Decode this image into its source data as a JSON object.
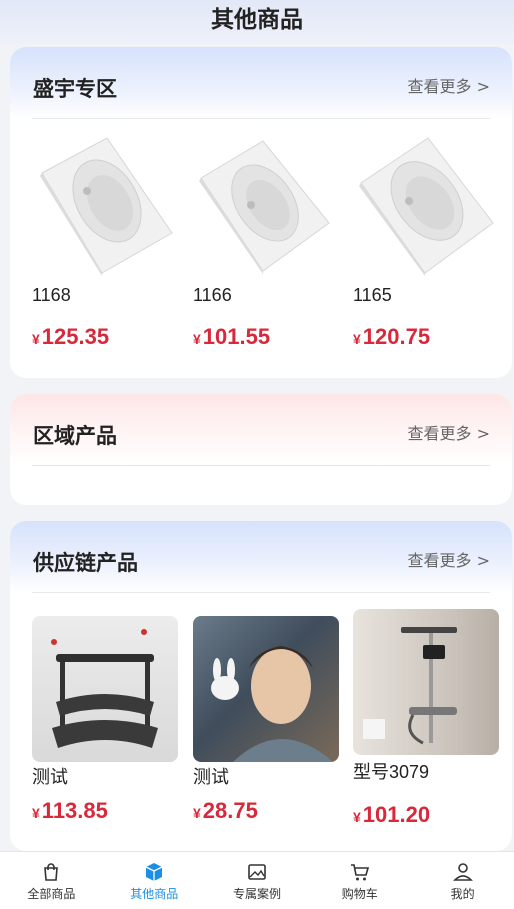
{
  "header": {
    "title": "其他商品"
  },
  "sections": [
    {
      "title": "盛宇专区",
      "more": "查看更多 >",
      "products": [
        {
          "name": "1168",
          "currency": "¥",
          "price": "125.35"
        },
        {
          "name": "1166",
          "currency": "¥",
          "price": "101.55"
        },
        {
          "name": "1165",
          "currency": "¥",
          "price": "120.75"
        }
      ]
    },
    {
      "title": "区域产品",
      "more": "查看更多 >"
    },
    {
      "title": "供应链产品",
      "more": "查看更多 >",
      "products": [
        {
          "name": "测试",
          "currency": "¥",
          "price": "113.85"
        },
        {
          "name": "测试",
          "currency": "¥",
          "price": "28.75"
        },
        {
          "name": "型号3079",
          "currency": "¥",
          "price": "101.20"
        }
      ]
    }
  ],
  "tabbar": [
    {
      "label": "全部商品",
      "icon": "bag-icon"
    },
    {
      "label": "其他商品",
      "icon": "cube-icon",
      "active": true
    },
    {
      "label": "专属案例",
      "icon": "image-icon"
    },
    {
      "label": "购物车",
      "icon": "cart-icon"
    },
    {
      "label": "我的",
      "icon": "user-icon"
    }
  ],
  "colors": {
    "price": "#d8283a",
    "active_tab": "#1a8fe3"
  }
}
